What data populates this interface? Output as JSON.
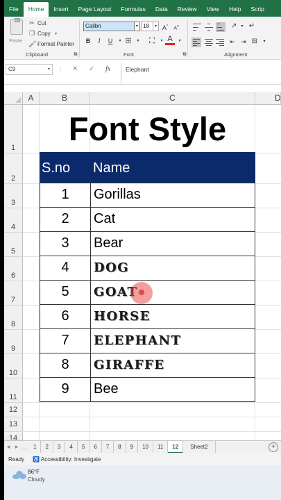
{
  "ribbon": {
    "tabs": [
      "File",
      "Home",
      "Insert",
      "Page Layout",
      "Formulas",
      "Data",
      "Review",
      "View",
      "Help",
      "Scrip"
    ],
    "active_tab": "Home",
    "clipboard": {
      "paste": "Paste",
      "cut": "Cut",
      "copy": "Copy",
      "format_painter": "Format Painter",
      "group_label": "Clipboard"
    },
    "font": {
      "name": "Calibri",
      "size": "18",
      "group_label": "Font"
    },
    "alignment": {
      "group_label": "Alignment"
    }
  },
  "formula_bar": {
    "name_box": "C9",
    "fx": "fx",
    "value": "Elephant"
  },
  "columns": [
    "A",
    "B",
    "C",
    "D"
  ],
  "rows": [
    "1",
    "2",
    "3",
    "4",
    "5",
    "6",
    "7",
    "8",
    "9",
    "10",
    "11",
    "12",
    "13",
    "14"
  ],
  "sheet": {
    "title": "Font Style",
    "header": {
      "sno": "S.no",
      "name": "Name"
    },
    "data": [
      {
        "sno": "1",
        "name": "Gorillas",
        "style": "normal"
      },
      {
        "sno": "2",
        "name": "Cat",
        "style": "normal"
      },
      {
        "sno": "3",
        "name": "Bear",
        "style": "normal"
      },
      {
        "sno": "4",
        "name": "DOG",
        "style": "decorative"
      },
      {
        "sno": "5",
        "name": "GOAT",
        "style": "decorative"
      },
      {
        "sno": "6",
        "name": "HORSE",
        "style": "decorative"
      },
      {
        "sno": "7",
        "name": "ELEPHANT",
        "style": "decorative"
      },
      {
        "sno": "8",
        "name": "GIRAFFE",
        "style": "decorative"
      },
      {
        "sno": "9",
        "name": "Bee",
        "style": "normal"
      }
    ]
  },
  "sheet_tabs": [
    "1",
    "2",
    "3",
    "4",
    "5",
    "6",
    "7",
    "8",
    "9",
    "10",
    "11",
    "12",
    "Sheet2"
  ],
  "active_sheet": "12",
  "status": {
    "ready": "Ready",
    "accessibility": "Accessibility: Investigate"
  },
  "weather": {
    "temp": "86°F",
    "condition": "Cloudy"
  },
  "colors": {
    "excel_green": "#217346",
    "header_fill": "#0b2a6b"
  }
}
